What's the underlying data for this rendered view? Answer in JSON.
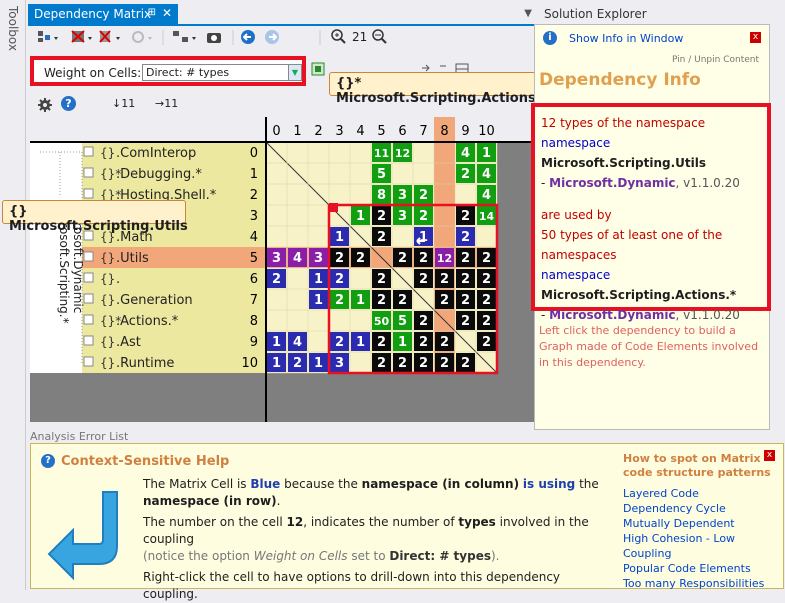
{
  "toolbox": {
    "label": "Toolbox"
  },
  "tab": {
    "title": "Dependency Matrix",
    "pin": "⊞",
    "close": "✕",
    "dropdown": "▼"
  },
  "toolbar": {
    "zoom_value": "21"
  },
  "weight": {
    "label": "Weight on Cells:",
    "value": "Direct: # types"
  },
  "counts": {
    "rows": "↓11",
    "cols": "→11"
  },
  "tooltips": {
    "top": "{}* Microsoft.Scripting.Actions.*",
    "left": "{} Microsoft.Scripting.Utils"
  },
  "matrix": {
    "columns": [
      "0",
      "1",
      "2",
      "3",
      "4",
      "5",
      "6",
      "7",
      "8",
      "9",
      "10"
    ],
    "rows": [
      {
        "label": ".ComInterop",
        "prefix": "{}",
        "idx": "0"
      },
      {
        "label": ".Debugging.*",
        "prefix": "{}*",
        "idx": "1"
      },
      {
        "label": ".Hosting.Shell.*",
        "prefix": "{}*",
        "idx": "2"
      },
      {
        "label": "",
        "prefix": "{}",
        "idx": "3"
      },
      {
        "label": ".Math",
        "prefix": "{}",
        "idx": "4"
      },
      {
        "label": ".Utils",
        "prefix": "{}",
        "idx": "5"
      },
      {
        "label": ".",
        "prefix": "{}",
        "idx": "6"
      },
      {
        "label": ".Generation",
        "prefix": "{}",
        "idx": "7"
      },
      {
        "label": ".Actions.*",
        "prefix": "{}*",
        "idx": "8"
      },
      {
        "label": ".Ast",
        "prefix": "{}",
        "idx": "9"
      },
      {
        "label": ".Runtime",
        "prefix": "{}",
        "idx": "10"
      }
    ],
    "tree_labels": [
      "Microsoft.Scripting.*",
      "Microsoft.Dynamic"
    ],
    "cells": [
      [
        "d",
        "",
        "",
        "",
        "",
        "g:11",
        "g:12",
        "",
        "",
        "g:4",
        "g:1"
      ],
      [
        "",
        "d",
        "",
        "",
        "",
        "g:5",
        "",
        "",
        "",
        "g:2",
        "g:4"
      ],
      [
        "",
        "",
        "d",
        "",
        "",
        "g:8",
        "g:3",
        "g:2",
        "",
        "",
        "g:4"
      ],
      [
        "",
        "",
        "",
        "d",
        "g:1",
        "k:2",
        "g:3",
        "g:2",
        "",
        "k:2",
        "g:14"
      ],
      [
        "",
        "",
        "",
        "b:1",
        "d",
        "k:2",
        "",
        "b:1",
        "",
        "b:2",
        ""
      ],
      [
        "p:3",
        "p:4",
        "p:3",
        "k:2",
        "k:2",
        "d",
        "k:2",
        "k:2",
        "p:12",
        "k:2",
        "k:2"
      ],
      [
        "b:2",
        "",
        "b:1",
        "b:2",
        "",
        "k:2",
        "d",
        "k:2",
        "k:2",
        "k:2",
        "k:2"
      ],
      [
        "",
        "",
        "b:1",
        "g:2",
        "g:1",
        "k:2",
        "k:2",
        "d",
        "k:2",
        "k:2",
        "k:2"
      ],
      [
        "",
        "",
        "",
        "",
        "",
        "g:50",
        "g:5",
        "k:2",
        "d",
        "k:2",
        "k:2"
      ],
      [
        "b:1",
        "b:4",
        "",
        "b:2",
        "b:1",
        "k:2",
        "g:1",
        "k:2",
        "k:2",
        "d",
        "k:2"
      ],
      [
        "b:1",
        "b:2",
        "b:1",
        "b:3",
        "",
        "k:2",
        "k:2",
        "k:2",
        "k:2",
        "k:2",
        "d"
      ]
    ]
  },
  "solution_explorer": {
    "label": "Solution Explorer"
  },
  "dep_info": {
    "show_info": "Show Info in Window",
    "pin_unpin": "Pin / Unpin Content",
    "title": "Dependency Info",
    "line1": "12 types of the namespace",
    "ns_kw": "namespace",
    "ns1": "Microsoft.Scripting.Utils",
    "asm_prefix": "- ",
    "asm": "Microsoft.Dynamic",
    "ver": ", v1.1.0.20",
    "line2": "are used by",
    "line3": "50 types of at least one of the namespaces",
    "ns2": "Microsoft.Scripting.Actions.*",
    "footer": "Left click the dependency to build a Graph made of Code Elements involved in this dependency."
  },
  "analysis_error_list": "Analysis Error List",
  "help": {
    "title": "Context-Sensitive Help",
    "p1a": "The Matrix Cell is ",
    "p1b": "Blue",
    "p1c": " because the ",
    "p1d": "namespace (in column)",
    "p1e": " ",
    "p1f": "is using",
    "p1g": " the ",
    "p1h": "namespace (in row)",
    "p1i": ".",
    "p2a": "The number on the cell ",
    "p2b": "12",
    "p2c": ", indicates the number of ",
    "p2d": "types",
    "p2e": " involved in the coupling",
    "p3a": "(notice the option ",
    "p3b": "Weight on Cells",
    "p3c": " set to ",
    "p3d": "Direct: # types",
    "p3e": ").",
    "p4": "Right-click the cell to have options to drill-down into this dependency coupling.",
    "patterns_title": "How to spot on Matrix code structure patterns",
    "patterns": [
      "Layered Code",
      "Dependency Cycle",
      "Mutually Dependent",
      "High Cohesion - Low Coupling",
      "Popular Code Elements",
      "Too many Responsibilities"
    ]
  },
  "colors": {
    "green": "#119e11",
    "blue": "#2b2bb0",
    "black": "#0a0a0a",
    "purple": "#8b1ea8",
    "highlight": "#f2a77a",
    "accent": "#007acc"
  }
}
